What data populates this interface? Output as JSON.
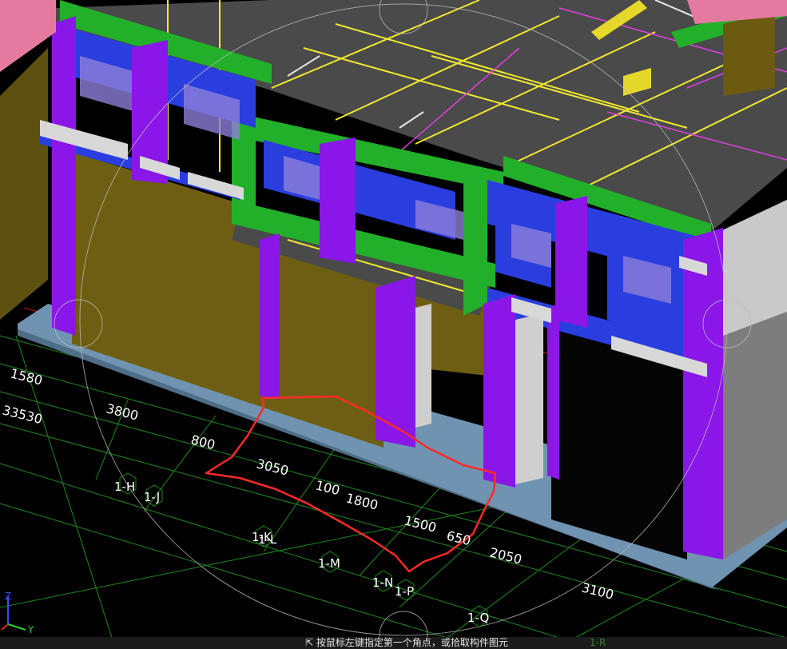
{
  "viewport": {
    "grid_tags": [
      "1-H",
      "1-J",
      "1-K",
      "1-L",
      "1-M",
      "1-N",
      "1-P",
      "1-Q"
    ],
    "dimensions": [
      "1580",
      "33530",
      "3800",
      "800",
      "3050",
      "100",
      "1800",
      "1500",
      "650",
      "2050",
      "3100"
    ],
    "axes": {
      "z": "Z",
      "y": "Y"
    },
    "colors": {
      "background": "#000000",
      "grid_line": "#1e8a1e",
      "axis_red": "#cc2020",
      "slab": "#4a4a4a",
      "beam_green": "#22b02a",
      "column_purple": "#8a16e8",
      "window_blue": "#2a3ee0",
      "wall_olive": "#6e5e12",
      "rebar_yellow": "#f0e830",
      "pipe_magenta": "#e040e0",
      "markup_red": "#ff2a2a",
      "base_slab": "#6f93b0"
    }
  },
  "status_bar": {
    "text": "⇱ 按鼠标左键指定第一个角点，或拾取构件图元",
    "extra": "1-R"
  }
}
